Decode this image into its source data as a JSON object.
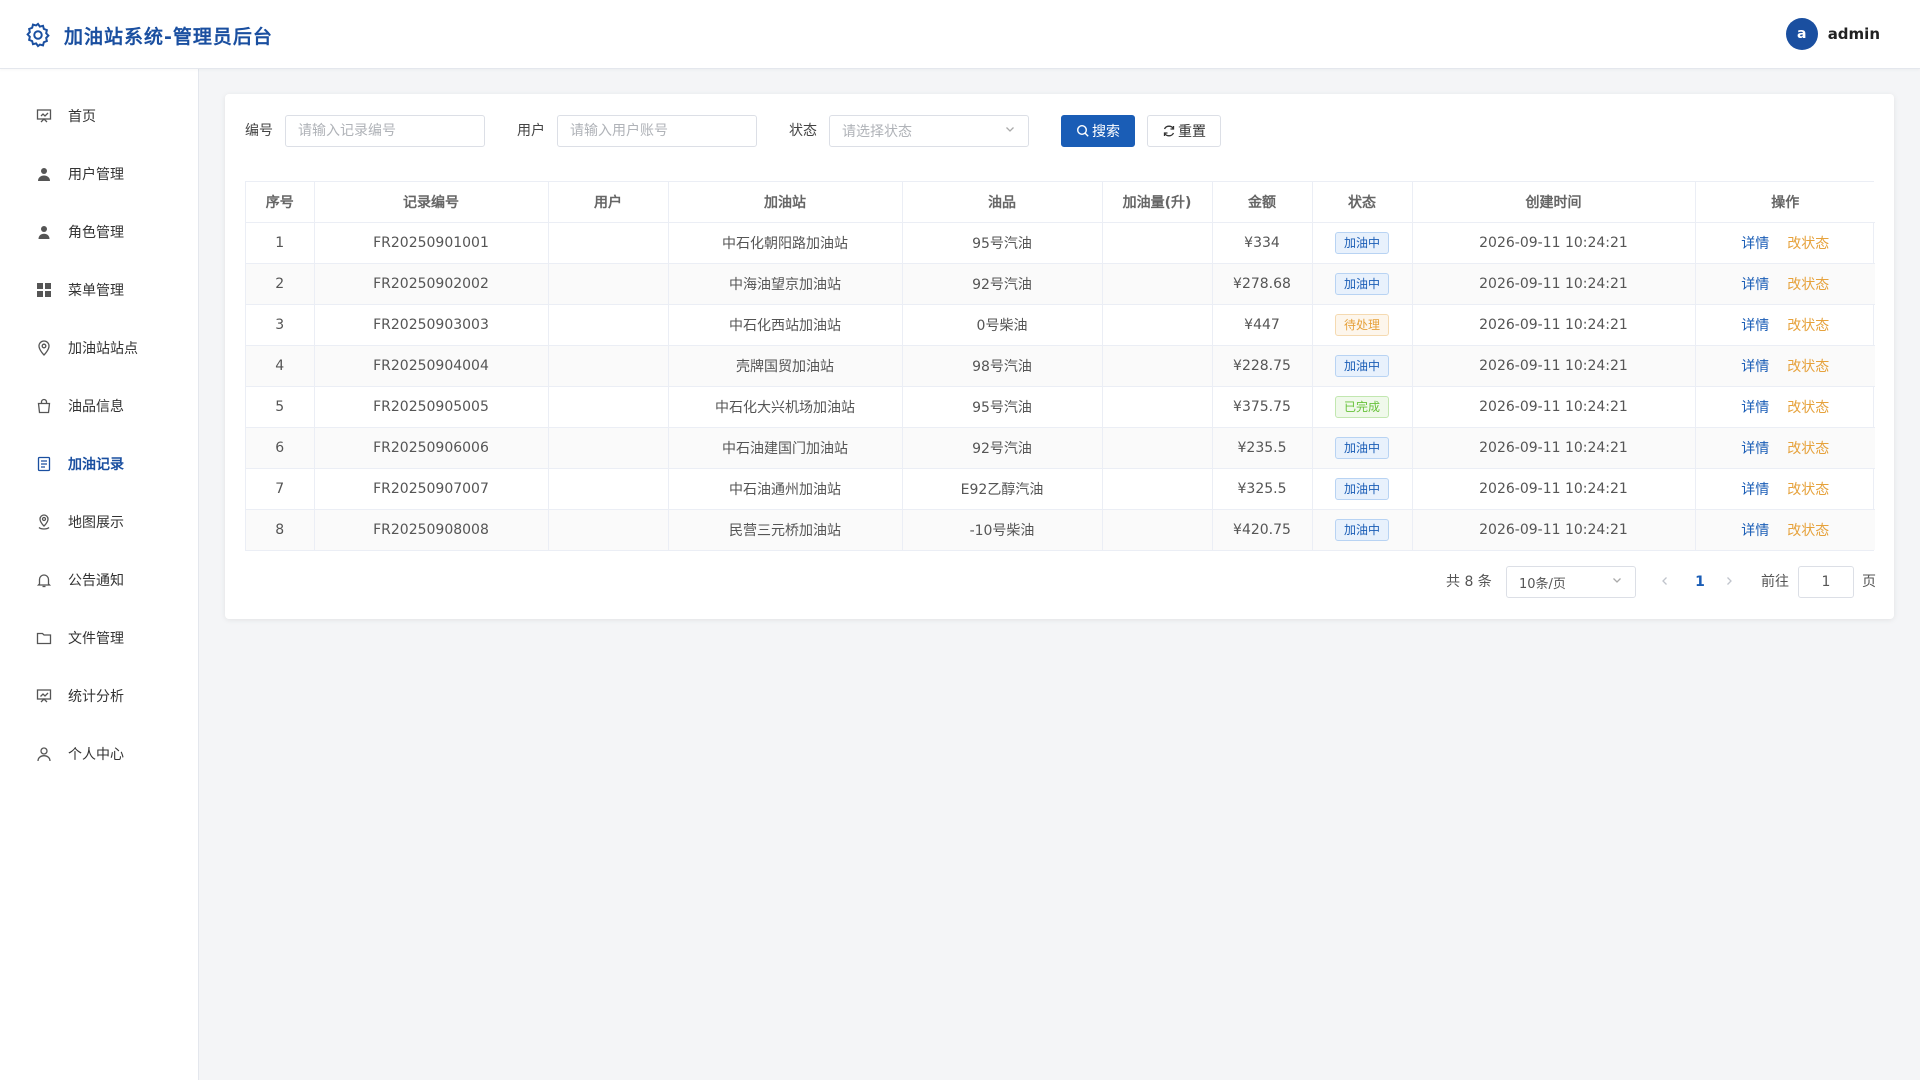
{
  "header": {
    "title": "加油站系统-管理员后台",
    "avatar_letter": "a",
    "username": "admin"
  },
  "sidebar": {
    "items": [
      {
        "label": "首页",
        "icon": "dashboard-icon"
      },
      {
        "label": "用户管理",
        "icon": "user-icon"
      },
      {
        "label": "角色管理",
        "icon": "role-icon"
      },
      {
        "label": "菜单管理",
        "icon": "grid-icon"
      },
      {
        "label": "加油站站点",
        "icon": "location-icon"
      },
      {
        "label": "油品信息",
        "icon": "bag-icon"
      },
      {
        "label": "加油记录",
        "icon": "document-icon",
        "active": true
      },
      {
        "label": "地图展示",
        "icon": "map-pin-icon"
      },
      {
        "label": "公告通知",
        "icon": "bell-icon"
      },
      {
        "label": "文件管理",
        "icon": "folder-icon"
      },
      {
        "label": "统计分析",
        "icon": "chart-icon"
      },
      {
        "label": "个人中心",
        "icon": "person-icon"
      }
    ]
  },
  "filters": {
    "code_label": "编号",
    "code_placeholder": "请输入记录编号",
    "user_label": "用户",
    "user_placeholder": "请输入用户账号",
    "status_label": "状态",
    "status_placeholder": "请选择状态",
    "search_label": "搜索",
    "reset_label": "重置"
  },
  "table": {
    "columns": [
      "序号",
      "记录编号",
      "用户",
      "加油站",
      "油品",
      "加油量(升)",
      "金额",
      "状态",
      "创建时间",
      "操作"
    ],
    "rows": [
      {
        "no": "1",
        "code": "FR20250901001",
        "user": "",
        "station": "中石化朝阳路加油站",
        "oil": "95号汽油",
        "volume": "",
        "amount": "¥334",
        "status": "加油中",
        "status_type": "blue",
        "created": "2026-09-11 10:24:21"
      },
      {
        "no": "2",
        "code": "FR20250902002",
        "user": "",
        "station": "中海油望京加油站",
        "oil": "92号汽油",
        "volume": "",
        "amount": "¥278.68",
        "status": "加油中",
        "status_type": "blue",
        "created": "2026-09-11 10:24:21"
      },
      {
        "no": "3",
        "code": "FR20250903003",
        "user": "",
        "station": "中石化西站加油站",
        "oil": "0号柴油",
        "volume": "",
        "amount": "¥447",
        "status": "待处理",
        "status_type": "orange",
        "created": "2026-09-11 10:24:21"
      },
      {
        "no": "4",
        "code": "FR20250904004",
        "user": "",
        "station": "壳牌国贸加油站",
        "oil": "98号汽油",
        "volume": "",
        "amount": "¥228.75",
        "status": "加油中",
        "status_type": "blue",
        "created": "2026-09-11 10:24:21"
      },
      {
        "no": "5",
        "code": "FR20250905005",
        "user": "",
        "station": "中石化大兴机场加油站",
        "oil": "95号汽油",
        "volume": "",
        "amount": "¥375.75",
        "status": "已完成",
        "status_type": "green",
        "created": "2026-09-11 10:24:21"
      },
      {
        "no": "6",
        "code": "FR20250906006",
        "user": "",
        "station": "中石油建国门加油站",
        "oil": "92号汽油",
        "volume": "",
        "amount": "¥235.5",
        "status": "加油中",
        "status_type": "blue",
        "created": "2026-09-11 10:24:21"
      },
      {
        "no": "7",
        "code": "FR20250907007",
        "user": "",
        "station": "中石油通州加油站",
        "oil": "E92乙醇汽油",
        "volume": "",
        "amount": "¥325.5",
        "status": "加油中",
        "status_type": "blue",
        "created": "2026-09-11 10:24:21"
      },
      {
        "no": "8",
        "code": "FR20250908008",
        "user": "",
        "station": "民营三元桥加油站",
        "oil": "-10号柴油",
        "volume": "",
        "amount": "¥420.75",
        "status": "加油中",
        "status_type": "blue",
        "created": "2026-09-11 10:24:21"
      }
    ],
    "action_detail": "详情",
    "action_status": "改状态"
  },
  "pagination": {
    "total_text": "共 8 条",
    "page_size": "10条/页",
    "current_page": "1",
    "goto_label": "前往",
    "goto_value": "1",
    "page_unit": "页"
  },
  "colors": {
    "primary": "#1a5db6",
    "brand_title": "#1a4fa0",
    "warning": "#e6a23c",
    "success": "#67c23a"
  }
}
